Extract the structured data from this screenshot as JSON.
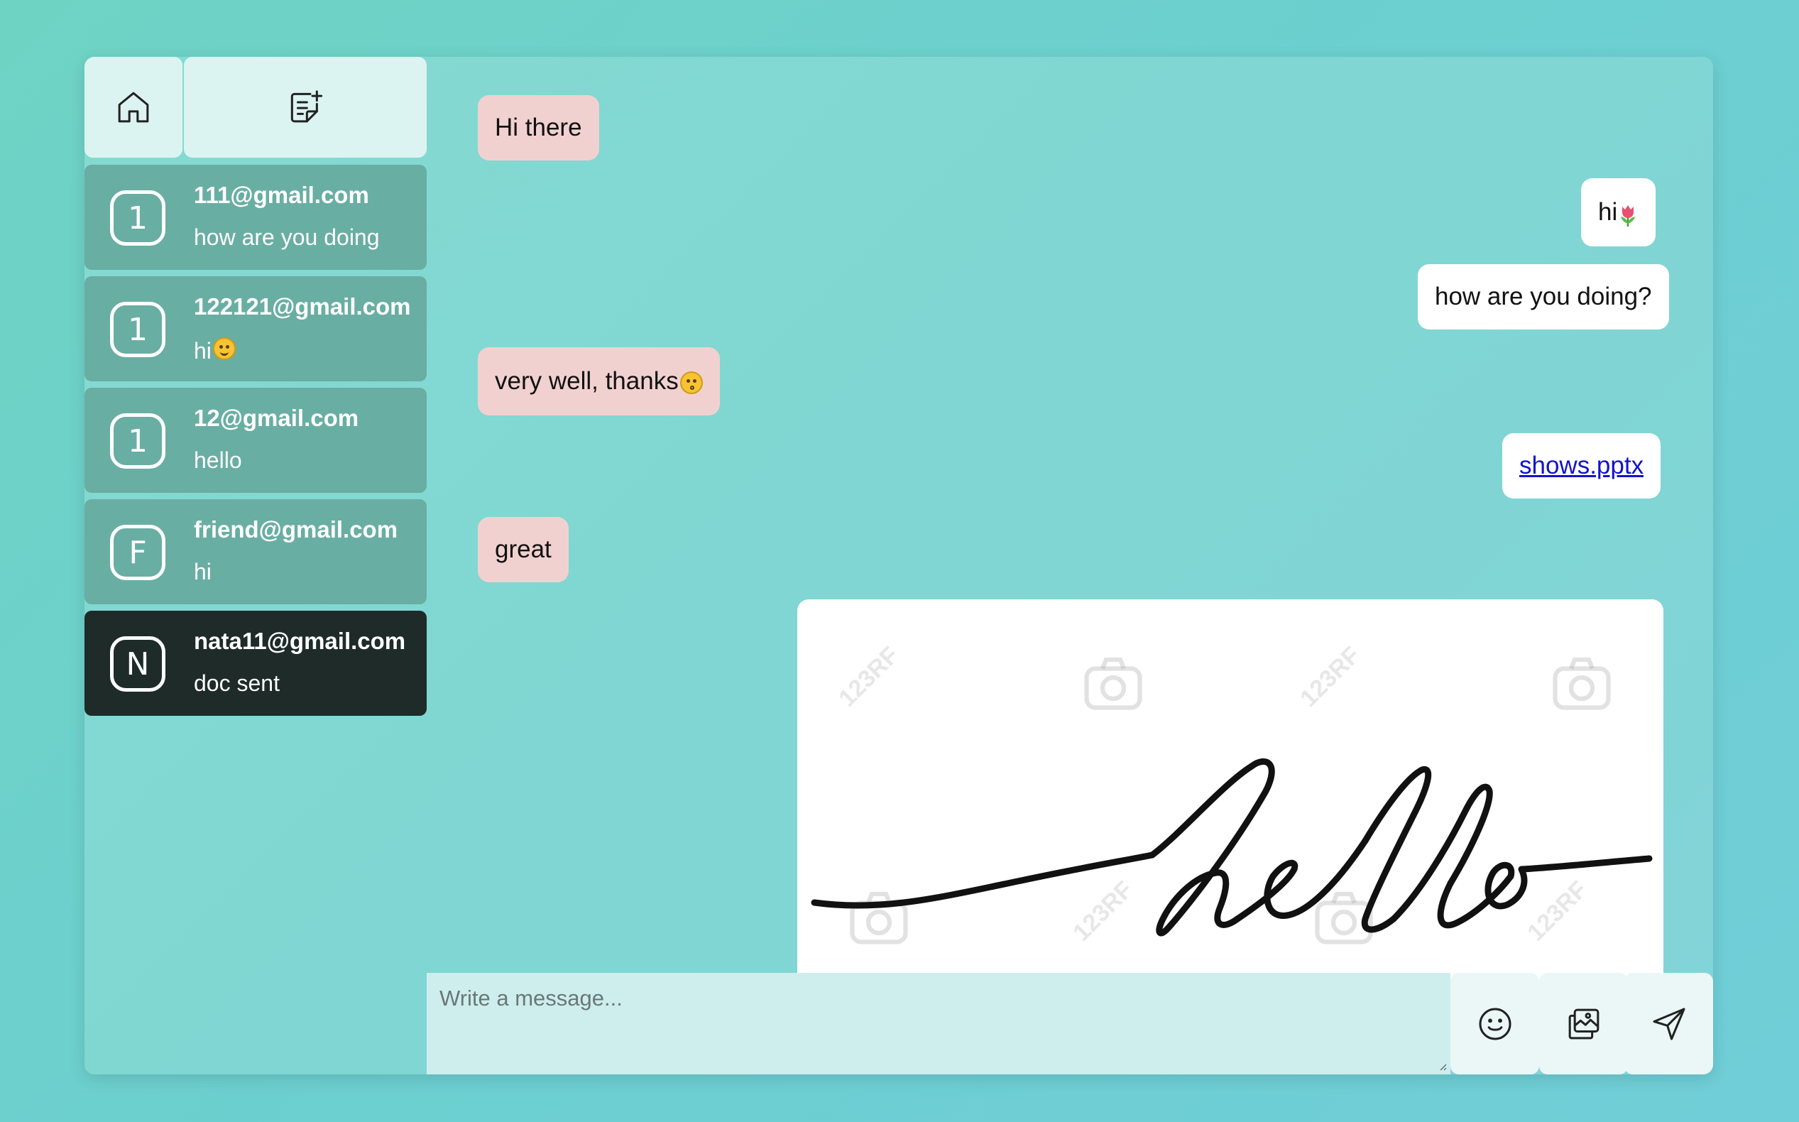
{
  "sidebar": {
    "contacts": [
      {
        "initial": "1",
        "email": "111@gmail.com",
        "preview": "how are you doing",
        "active": false
      },
      {
        "initial": "1",
        "email": "122121@gmail.com",
        "preview": "hi",
        "preview_emoji": "grinning-face",
        "active": false
      },
      {
        "initial": "1",
        "email": "12@gmail.com",
        "preview": "hello",
        "active": false
      },
      {
        "initial": "F",
        "email": "friend@gmail.com",
        "preview": "hi",
        "active": false
      },
      {
        "initial": "N",
        "email": "nata11@gmail.com",
        "preview": "doc sent",
        "active": true
      }
    ]
  },
  "chat": {
    "messages": [
      {
        "direction": "in",
        "text": "Hi there"
      },
      {
        "direction": "out",
        "text": "hi",
        "emoji": "tulip"
      },
      {
        "direction": "out",
        "text": "how are you doing?"
      },
      {
        "direction": "in",
        "text": "very well, thanks",
        "emoji": "kissing-face"
      },
      {
        "direction": "out",
        "link": "shows.pptx"
      },
      {
        "direction": "in",
        "text": "great"
      },
      {
        "direction": "out",
        "image_text": "hello",
        "watermark": "123RF"
      }
    ]
  },
  "composer": {
    "placeholder": "Write a message..."
  },
  "icons": {
    "home": "home-icon",
    "compose": "new-chat-icon",
    "emoji": "smiley-icon",
    "image": "image-upload-icon",
    "send": "send-icon"
  },
  "colors": {
    "background": "#6fd3c4",
    "incoming_bubble": "#f1d1d0",
    "outgoing_bubble": "#ffffff",
    "contact_item": "#69aea3",
    "active_contact": "#1e2b29",
    "link": "#1313c9"
  }
}
